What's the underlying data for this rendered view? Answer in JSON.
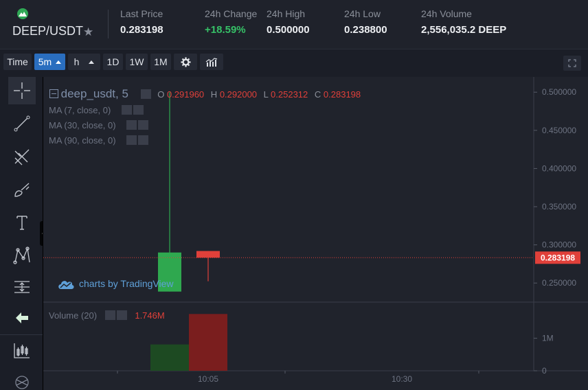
{
  "header": {
    "pair": "DEEP/USDT",
    "stats": [
      {
        "label": "Last Price",
        "value": "0.283198",
        "color": "#eef0f3"
      },
      {
        "label": "24h Change",
        "value": "+18.59%",
        "color": "#36c167"
      },
      {
        "label": "24h High",
        "value": "0.500000",
        "color": "#eef0f3"
      },
      {
        "label": "24h Low",
        "value": "0.238800",
        "color": "#eef0f3"
      },
      {
        "label": "24h Volume",
        "value": "2,556,035.2 DEEP",
        "color": "#eef0f3"
      }
    ]
  },
  "toolbar": {
    "time_label": "Time",
    "intervals": [
      {
        "label": "5m",
        "active": true,
        "dropdown": true
      },
      {
        "label": "h",
        "active": false,
        "dropdown": true
      },
      {
        "label": "1D",
        "active": false,
        "dropdown": false
      },
      {
        "label": "1W",
        "active": false,
        "dropdown": false
      },
      {
        "label": "1M",
        "active": false,
        "dropdown": false
      }
    ],
    "icons": [
      "settings-icon",
      "indicators-icon"
    ]
  },
  "tools": [
    "crosshair-icon",
    "trend-line-icon",
    "fib-icon",
    "brush-icon",
    "text-icon",
    "pattern-icon",
    "measure-icon",
    "back-arrow-icon",
    "candle-chart-icon",
    "web-icon"
  ],
  "chart": {
    "symbol_label": "deep_usdt, 5",
    "ohlc": [
      {
        "key": "O",
        "value": "0.291960"
      },
      {
        "key": "H",
        "value": "0.292000"
      },
      {
        "key": "L",
        "value": "0.252312"
      },
      {
        "key": "C",
        "value": "0.283198"
      }
    ],
    "indicators": [
      "MA (7, close, 0)",
      "MA (30, close, 0)",
      "MA (90, close, 0)"
    ],
    "watermark": "charts by TradingView",
    "volume_label": "Volume (20)",
    "volume_value": "1.746M",
    "last_price_tag": "0.283198",
    "colors": {
      "up": "#2fa84f",
      "down": "#e0403a",
      "vol_up": "#1d4a22",
      "vol_down": "#7a1e1e"
    }
  },
  "chart_data": {
    "type": "candlestick",
    "price_axis_ticks": [
      "0.500000",
      "0.450000",
      "0.400000",
      "0.350000",
      "0.300000",
      "0.250000"
    ],
    "price_range": [
      0.225,
      0.52
    ],
    "time_axis_ticks": [
      "10:05",
      "10:30"
    ],
    "volume_axis_ticks": [
      "1M",
      "0"
    ],
    "volume_range": [
      0,
      1.9
    ],
    "candles": [
      {
        "open": 0.2388,
        "high": 0.5,
        "low": 0.2388,
        "close": 0.29
      },
      {
        "open": 0.29196,
        "high": 0.292,
        "low": 0.252312,
        "close": 0.283198
      }
    ],
    "volumes_millions": [
      0.81,
      1.746
    ],
    "last_price": 0.283198
  }
}
